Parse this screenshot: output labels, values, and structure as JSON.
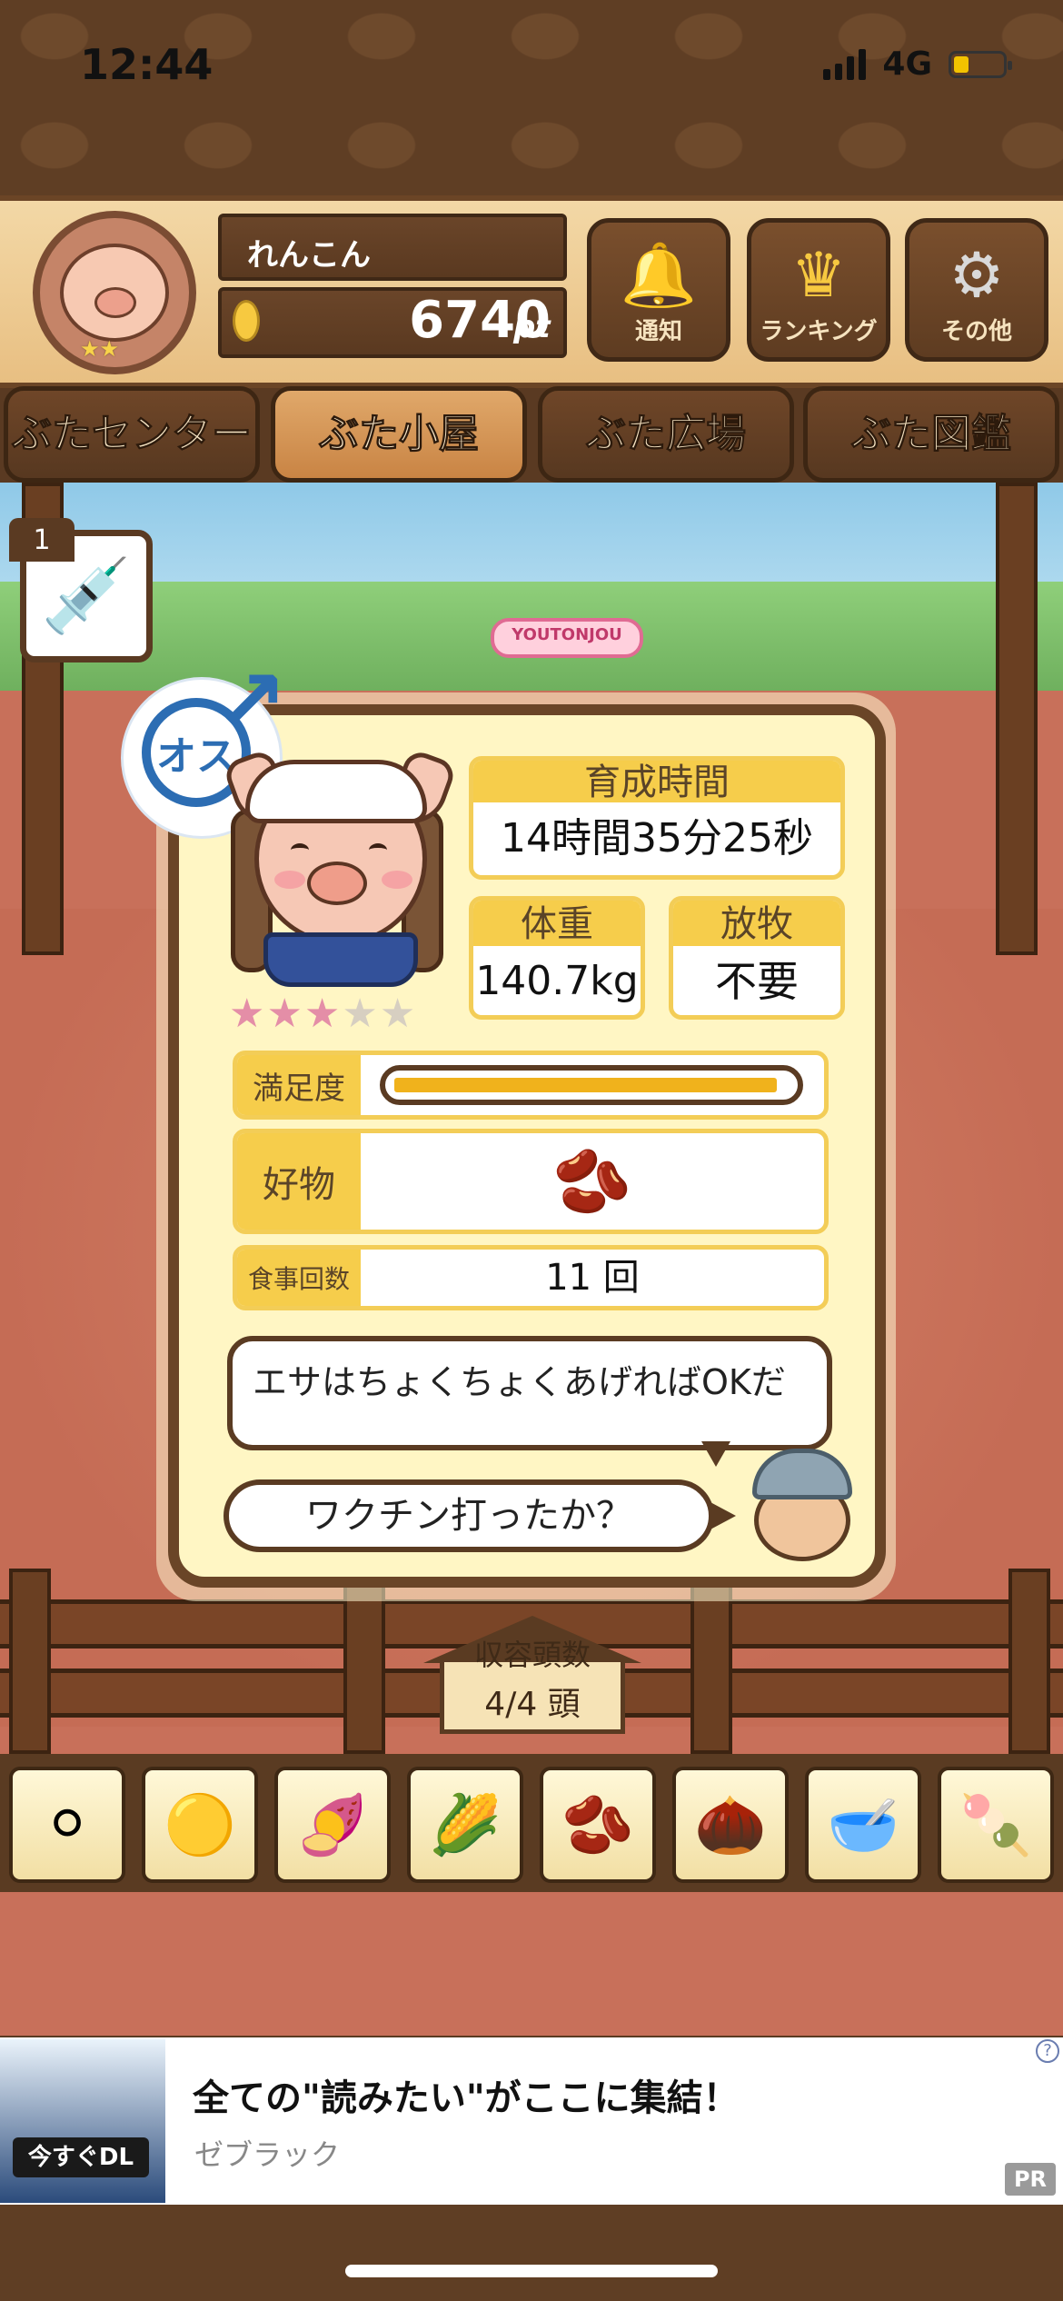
{
  "status_bar": {
    "time": "12:44",
    "network": "4G"
  },
  "header": {
    "user_name": "れんこん",
    "points": "6740",
    "points_unit": "pt",
    "buttons": [
      {
        "icon": "bell-icon",
        "label": "通知"
      },
      {
        "icon": "crown-icon",
        "label": "ランキング"
      },
      {
        "icon": "gear-icon",
        "label": "その他"
      }
    ]
  },
  "tabs": [
    {
      "label": "ぶたセンター",
      "active": false
    },
    {
      "label": "ぶた小屋",
      "active": true
    },
    {
      "label": "ぶた広場",
      "active": false
    },
    {
      "label": "ぶた図鑑",
      "active": false
    }
  ],
  "item": {
    "count": "1",
    "icon": "syringe-icon"
  },
  "scene": {
    "gate_sign": "YOUTONJOU"
  },
  "pig": {
    "gender": "オス",
    "rating": 3,
    "rating_max": 5,
    "growth_time_label": "育成時間",
    "growth_time": "14時間35分25秒",
    "weight_label": "体重",
    "weight": "140.7kg",
    "grazing_label": "放牧",
    "grazing": "不要",
    "satisfaction_label": "満足度",
    "satisfaction": 0.97,
    "favorite_label": "好物",
    "favorite_icon": "soybean-icon",
    "meals_label": "食事回数",
    "meals": "11 回"
  },
  "dialog": {
    "tip": "エサはちょくちょくあげればOKだ",
    "question": "ワクチン打ったか？"
  },
  "capacity": {
    "label": "収容頭数",
    "value": "4/4 頭"
  },
  "food_items": [
    {
      "icon": "grain-icon"
    },
    {
      "icon": "mixed-grain-icon"
    },
    {
      "icon": "sweet-potato-icon"
    },
    {
      "icon": "corn-icon"
    },
    {
      "icon": "soybean-icon"
    },
    {
      "icon": "acorn-icon"
    },
    {
      "icon": "bowl-grain-icon"
    },
    {
      "icon": "plate-meatball-icon"
    }
  ],
  "ad": {
    "title": "全ての\"読みたい\"がここに集結！",
    "advertiser": "ゼブラック",
    "badge": "PR",
    "image_button": "今すぐDL"
  }
}
